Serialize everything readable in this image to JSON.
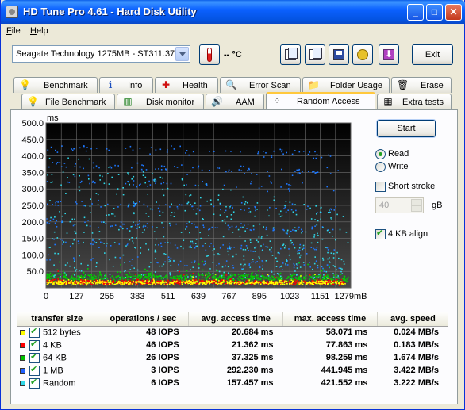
{
  "window": {
    "title": "HD Tune Pro 4.61 - Hard Disk Utility",
    "minimize": "_",
    "maximize": "□",
    "close": "✕"
  },
  "menu": [
    {
      "label": "File",
      "underline": "F",
      "rest": "ile"
    },
    {
      "label": "Help",
      "underline": "H",
      "rest": "elp"
    }
  ],
  "toolbar": {
    "drive": "Seagate Technology 1275MB - ST311.37",
    "temperature": "-- °C",
    "exit_label": "Exit",
    "icons": [
      "thermometer-icon",
      "copy-text-icon",
      "copy-screen-icon",
      "save-icon",
      "options-icon",
      "download-icon"
    ]
  },
  "tabs_row1": [
    {
      "label": "Benchmark",
      "icon": "bulb-icon",
      "glyph": "💡"
    },
    {
      "label": "Info",
      "icon": "info-icon",
      "glyph": "ℹ"
    },
    {
      "label": "Health",
      "icon": "health-cross-icon",
      "glyph": "✚"
    },
    {
      "label": "Error Scan",
      "icon": "magnifier-icon",
      "glyph": "🔍"
    },
    {
      "label": "Folder Usage",
      "icon": "folder-icon",
      "glyph": "📁"
    },
    {
      "label": "Erase",
      "icon": "trash-icon",
      "glyph": "🗑"
    }
  ],
  "tabs_row2": [
    {
      "label": "File Benchmark",
      "icon": "bulb-icon",
      "glyph": "💡"
    },
    {
      "label": "Disk monitor",
      "icon": "bar-chart-icon",
      "glyph": "▥"
    },
    {
      "label": "AAM",
      "icon": "speaker-icon",
      "glyph": "🔊"
    },
    {
      "label": "Random Access",
      "icon": "scatter-icon",
      "glyph": "⁘"
    },
    {
      "label": "Extra tests",
      "icon": "grid-icon",
      "glyph": "▦"
    }
  ],
  "active_tab": "Random Access",
  "controls": {
    "start_label": "Start",
    "read_label": "Read",
    "write_label": "Write",
    "mode": "Read",
    "short_stroke_label": "Short stroke",
    "short_stroke": false,
    "short_stroke_value": "40",
    "short_stroke_unit": "gB",
    "align_label": "4 KB align",
    "align": true
  },
  "chart_data": {
    "type": "scatter",
    "y_unit": "ms",
    "x_unit": "MB",
    "ylim": [
      0,
      500
    ],
    "xlim": [
      0,
      1279
    ],
    "y_ticks": [
      "500.0",
      "450.0",
      "400.0",
      "350.0",
      "300.0",
      "250.0",
      "200.0",
      "150.0",
      "100.0",
      "50.0"
    ],
    "x_ticks": [
      "0",
      "127",
      "255",
      "383",
      "511",
      "639",
      "767",
      "895",
      "1023",
      "1151",
      "1279mB"
    ],
    "grid": true,
    "background": "#000000",
    "series": [
      {
        "name": "512 bytes",
        "color": "#ffff00",
        "avg_ms": 20.684,
        "max_ms": 58.071
      },
      {
        "name": "4 KB",
        "color": "#ff0000",
        "avg_ms": 21.362,
        "max_ms": 77.863
      },
      {
        "name": "64 KB",
        "color": "#00d000",
        "avg_ms": 37.325,
        "max_ms": 98.259
      },
      {
        "name": "1 MB",
        "color": "#1e78ff",
        "avg_ms": 292.23,
        "max_ms": 441.945
      },
      {
        "name": "Random",
        "color": "#30d8e8",
        "avg_ms": 157.457,
        "max_ms": 421.552
      }
    ]
  },
  "results": {
    "headers": [
      "transfer size",
      "operations / sec",
      "avg. access time",
      "max. access time",
      "avg. speed"
    ],
    "rows": [
      {
        "size": "512 bytes",
        "color": "#ffff00",
        "ops": "48 IOPS",
        "avg": "20.684 ms",
        "max": "58.071 ms",
        "speed": "0.024 MB/s"
      },
      {
        "size": "4 KB",
        "color": "#ff0000",
        "ops": "46 IOPS",
        "avg": "21.362 ms",
        "max": "77.863 ms",
        "speed": "0.183 MB/s"
      },
      {
        "size": "64 KB",
        "color": "#00c000",
        "ops": "26 IOPS",
        "avg": "37.325 ms",
        "max": "98.259 ms",
        "speed": "1.674 MB/s"
      },
      {
        "size": "1 MB",
        "color": "#1e60ff",
        "ops": "3 IOPS",
        "avg": "292.230 ms",
        "max": "441.945 ms",
        "speed": "3.422 MB/s"
      },
      {
        "size": "Random",
        "color": "#30d8e8",
        "ops": "6 IOPS",
        "avg": "157.457 ms",
        "max": "421.552 ms",
        "speed": "3.222 MB/s"
      }
    ]
  }
}
